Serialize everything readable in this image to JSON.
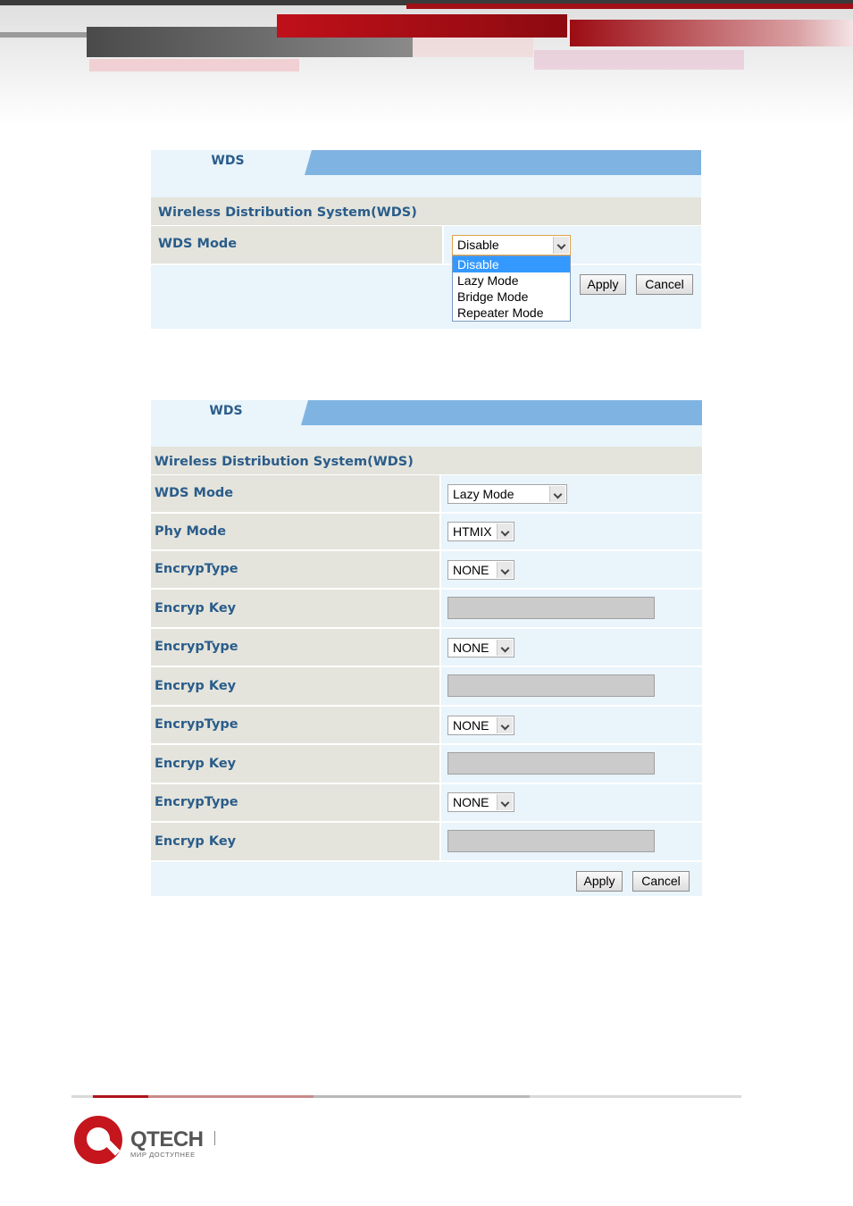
{
  "colors": {
    "brand_red": "#c5151d",
    "panel_bg": "#e9f4fb",
    "tab_bar": "#7fb3e1",
    "label_bg": "#e4e4dc",
    "label_text": "#2a5c8a",
    "highlight": "#3399ff"
  },
  "panel1": {
    "tab_label": "WDS",
    "section_title": "Wireless Distribution System(WDS)",
    "wds_mode_label": "WDS Mode",
    "wds_mode_value": "Disable",
    "dropdown_options": [
      "Disable",
      "Lazy Mode",
      "Bridge Mode",
      "Repeater Mode"
    ],
    "dropdown_selected_index": 0,
    "apply_label": "Apply",
    "cancel_label": "Cancel"
  },
  "panel2": {
    "tab_label": "WDS",
    "section_title": "Wireless Distribution System(WDS)",
    "wds_mode_label": "WDS Mode",
    "wds_mode_value": "Lazy Mode",
    "phy_mode_label": "Phy Mode",
    "phy_mode_value": "HTMIX",
    "encryption_rows": [
      {
        "type_label": "EncrypType",
        "type_value": "NONE",
        "key_label": "Encryp Key",
        "key_value": ""
      },
      {
        "type_label": "EncrypType",
        "type_value": "NONE",
        "key_label": "Encryp Key",
        "key_value": ""
      },
      {
        "type_label": "EncrypType",
        "type_value": "NONE",
        "key_label": "Encryp Key",
        "key_value": ""
      },
      {
        "type_label": "EncrypType",
        "type_value": "NONE",
        "key_label": "Encryp Key",
        "key_value": ""
      }
    ],
    "apply_label": "Apply",
    "cancel_label": "Cancel"
  },
  "footer": {
    "brand_name": "QTECH",
    "tagline": "МИР ДОСТУПНЕЕ"
  }
}
